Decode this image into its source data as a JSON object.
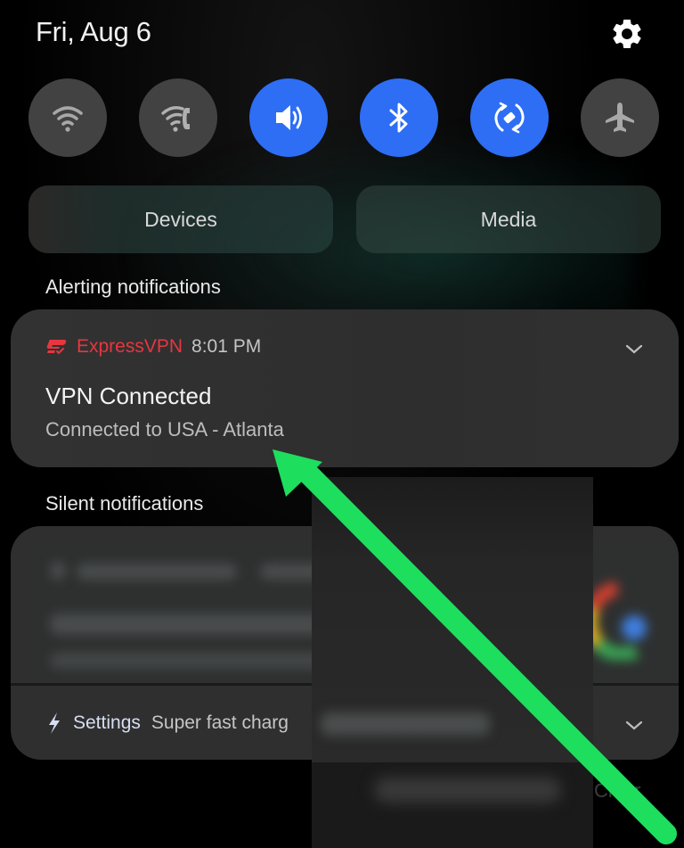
{
  "header": {
    "date": "Fri, Aug 6",
    "settings_icon": "gear-icon"
  },
  "quick_settings": [
    {
      "name": "wifi",
      "icon": "wifi-icon",
      "state": "off"
    },
    {
      "name": "wifi-calling",
      "icon": "wifi-calling-icon",
      "state": "off"
    },
    {
      "name": "sound",
      "icon": "volume-icon",
      "state": "on"
    },
    {
      "name": "bluetooth",
      "icon": "bluetooth-icon",
      "state": "on"
    },
    {
      "name": "auto-rotate",
      "icon": "auto-rotate-icon",
      "state": "on"
    },
    {
      "name": "airplane-mode",
      "icon": "airplane-icon",
      "state": "off"
    }
  ],
  "panels": {
    "devices_label": "Devices",
    "media_label": "Media"
  },
  "alerting": {
    "section_label": "Alerting notifications",
    "notification": {
      "app_name": "ExpressVPN",
      "time": "8:01 PM",
      "title": "VPN Connected",
      "body": "Connected to USA - Atlanta",
      "app_color": "#e8363f"
    }
  },
  "silent": {
    "section_label": "Silent notifications",
    "settings_notification": {
      "app_name": "Settings",
      "text": "Super fast charg"
    }
  },
  "footer": {
    "clear_label": "Clear"
  },
  "annotation": {
    "arrow_color": "#1ede5e"
  },
  "colors": {
    "toggle_on": "#2d6ef5",
    "toggle_off": "#424242",
    "card_bg": "#2e2e2e"
  }
}
